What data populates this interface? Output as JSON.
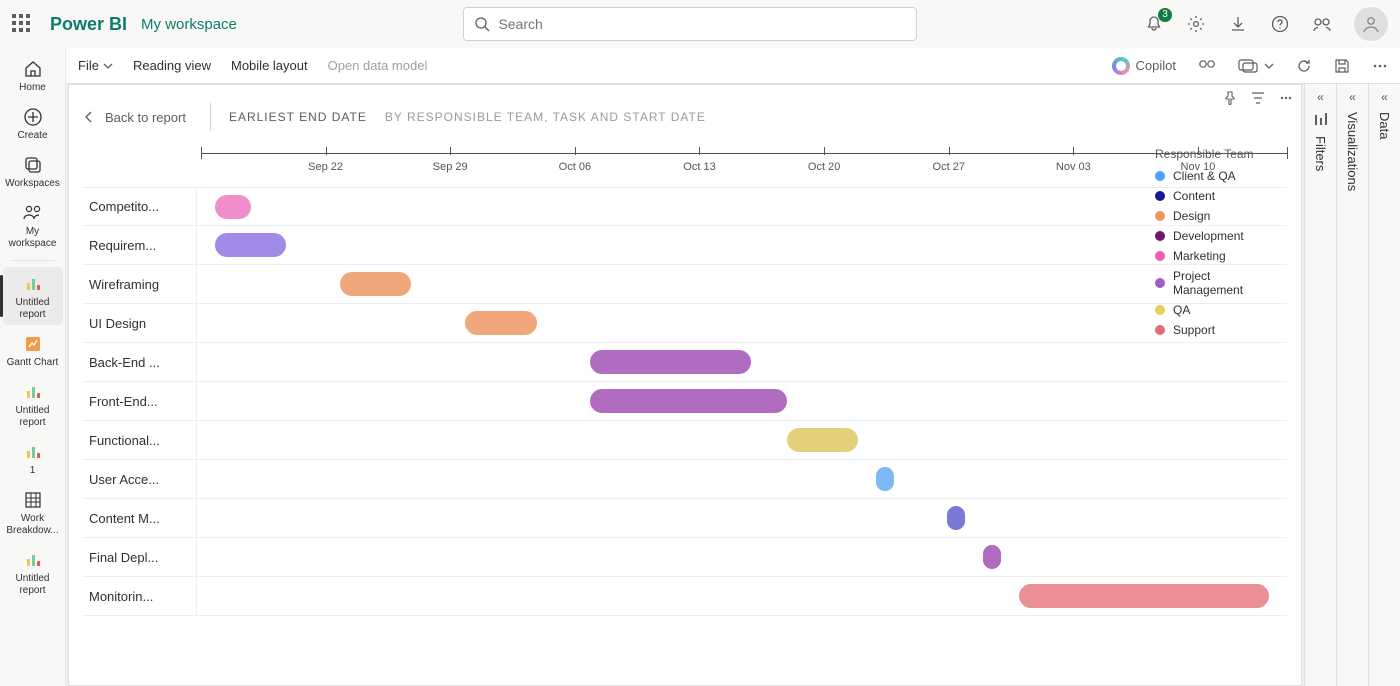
{
  "header": {
    "brand": "Power BI",
    "workspace": "My workspace",
    "search_placeholder": "Search",
    "notification_count": "3"
  },
  "leftnav": {
    "items": [
      {
        "id": "home",
        "label": "Home",
        "icon": "home"
      },
      {
        "id": "create",
        "label": "Create",
        "icon": "plus-circle"
      },
      {
        "id": "workspaces",
        "label": "Workspaces",
        "icon": "stack"
      },
      {
        "id": "myws",
        "label": "My workspace",
        "icon": "people"
      },
      {
        "id": "sep",
        "sep": true
      },
      {
        "id": "untitled1",
        "label": "Untitled report",
        "icon": "bar",
        "active": true
      },
      {
        "id": "gantt",
        "label": "Gantt Chart",
        "icon": "spark"
      },
      {
        "id": "untitled2",
        "label": "Untitled report",
        "icon": "bar"
      },
      {
        "id": "one",
        "label": "1",
        "icon": "bar"
      },
      {
        "id": "wbs",
        "label": "Work Breakdow...",
        "icon": "matrix"
      },
      {
        "id": "untitled3",
        "label": "Untitled report",
        "icon": "bar"
      }
    ]
  },
  "toolbar": {
    "file": "File",
    "reading": "Reading view",
    "mobile": "Mobile layout",
    "dm": "Open data model",
    "copilot": "Copilot"
  },
  "panes": {
    "filters": "Filters",
    "viz": "Visualizations",
    "data": "Data"
  },
  "drill": {
    "back": "Back to report",
    "t1": "EARLIEST END DATE",
    "t2": "BY RESPONSIBLE TEAM, TASK AND START DATE"
  },
  "legend": {
    "title": "Responsible Team",
    "items": [
      {
        "label": "Client & QA",
        "color": "#4aa3ff"
      },
      {
        "label": "Content",
        "color": "#171796"
      },
      {
        "label": "Design",
        "color": "#f0945b"
      },
      {
        "label": "Development",
        "color": "#6b1a6b"
      },
      {
        "label": "Marketing",
        "color": "#ef5fb0"
      },
      {
        "label": "Project Management",
        "color": "#a05bc7"
      },
      {
        "label": "QA",
        "color": "#e4d05a"
      },
      {
        "label": "Support",
        "color": "#e46a76"
      }
    ]
  },
  "chart_data": {
    "type": "bar",
    "orientation": "gantt",
    "x_axis": {
      "type": "date",
      "start": "2024-09-15",
      "end": "2024-11-15",
      "ticks": [
        "Sep 22",
        "Sep 29",
        "Oct 06",
        "Oct 13",
        "Oct 20",
        "Oct 27",
        "Nov 03",
        "Nov 10"
      ]
    },
    "tasks": [
      {
        "label": "Competito...",
        "team": "Marketing",
        "start": "2024-09-16",
        "end": "2024-09-18",
        "color": "#ef8ecb"
      },
      {
        "label": "Requirem...",
        "team": "Project Management",
        "start": "2024-09-16",
        "end": "2024-09-20",
        "color": "#a18be6"
      },
      {
        "label": "Wireframing",
        "team": "Design",
        "start": "2024-09-23",
        "end": "2024-09-27",
        "color": "#f0a77b"
      },
      {
        "label": "UI Design",
        "team": "Design",
        "start": "2024-09-30",
        "end": "2024-10-04",
        "color": "#f0a77b"
      },
      {
        "label": "Back-End ...",
        "team": "Development",
        "start": "2024-10-07",
        "end": "2024-10-16",
        "color": "#b06cc0"
      },
      {
        "label": "Front-End...",
        "team": "Development",
        "start": "2024-10-07",
        "end": "2024-10-18",
        "color": "#b06cc0"
      },
      {
        "label": "Functional...",
        "team": "QA",
        "start": "2024-10-18",
        "end": "2024-10-22",
        "color": "#e2d17a"
      },
      {
        "label": "User Acce...",
        "team": "Client & QA",
        "start": "2024-10-23",
        "end": "2024-10-24",
        "color": "#7cb8f5"
      },
      {
        "label": "Content M...",
        "team": "Content",
        "start": "2024-10-27",
        "end": "2024-10-28",
        "color": "#7a7ad6"
      },
      {
        "label": "Final Depl...",
        "team": "Development",
        "start": "2024-10-29",
        "end": "2024-10-30",
        "color": "#b06cc0"
      },
      {
        "label": "Monitorin...",
        "team": "Support",
        "start": "2024-10-31",
        "end": "2024-11-14",
        "color": "#ec8e96"
      }
    ]
  }
}
